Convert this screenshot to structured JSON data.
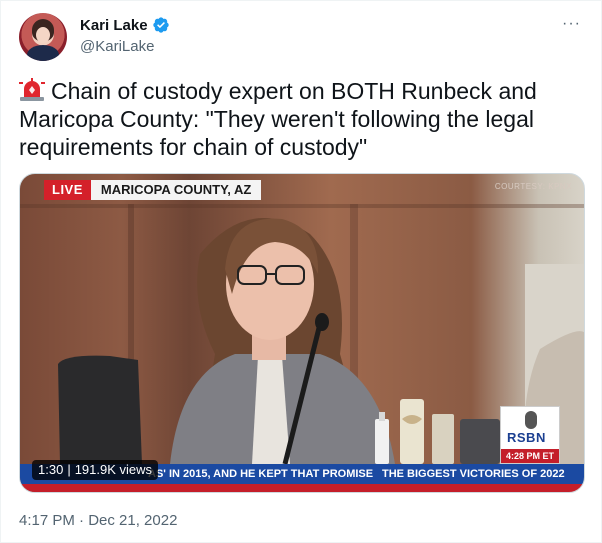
{
  "author": {
    "display_name": "Kari Lake",
    "handle": "@KariLake",
    "verified": true
  },
  "tweet": {
    "emoji": "rotating-light-emoji",
    "text": "Chain of custody expert on BOTH Runbeck and Maricopa County: \"They weren't following the legal requirements for chain of custody\"",
    "timestamp": "4:17 PM · Dec 21, 2022"
  },
  "menu": {
    "more_label": "···"
  },
  "video": {
    "live_label": "LIVE",
    "location_label": "MARICOPA COUNTY, AZ",
    "courtesy_label": "COURTESY: KPNX",
    "network_logo": "RSBN",
    "network_time": "4:28 PM ET",
    "ticker_text_1": "AS' IN 2015, AND HE KEPT THAT PROMISE",
    "ticker_text_2": "THE BIGGEST VICTORIES OF 2022",
    "duration": "1:30",
    "views": "191.9K views"
  },
  "colors": {
    "verified_blue": "#1d9bf0",
    "live_red": "#d4202a",
    "ticker_blue": "#1b4aa2",
    "secondary_text": "#536471"
  }
}
